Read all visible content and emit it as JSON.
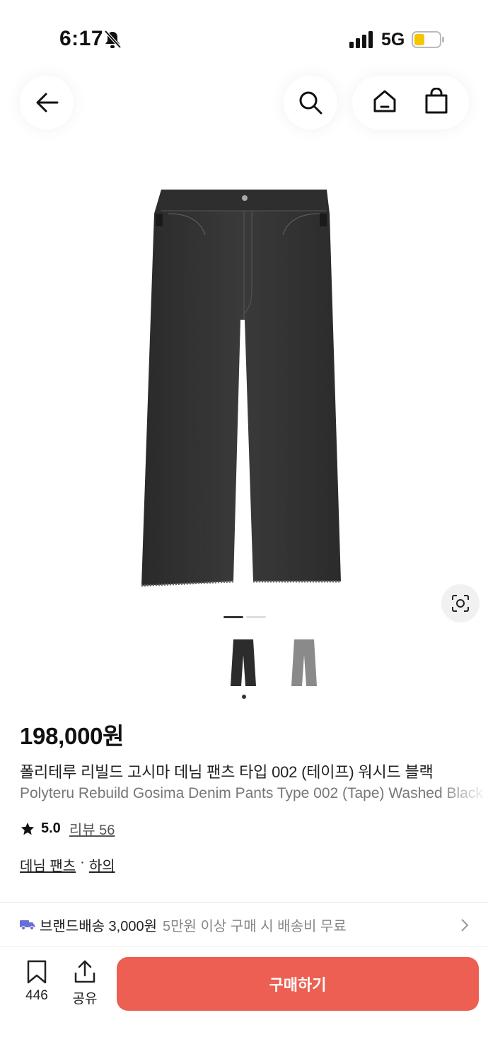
{
  "status_bar": {
    "time": "6:17",
    "network": "5G",
    "battery_color": "#f5c500"
  },
  "nav": {
    "back": "back-arrow-icon",
    "search": "search-icon",
    "home": "home-icon",
    "cart": "shopping-bag-icon"
  },
  "product": {
    "price": "198,000원",
    "name_ko": "폴리테루 리빌드 고시마 데님 팬츠 타입 002 (테이프) 워시드 블랙",
    "name_en": "Polyteru Rebuild Gosima Denim Pants Type 002 (Tape) Washed Black",
    "rating": "5.0",
    "review_label": "리뷰 56",
    "category": "데님 팬츠",
    "category_sep": "·",
    "subcategory": "하의",
    "image_count": 2,
    "current_image": 1
  },
  "shipping": {
    "label": "브랜드배송 3,000원",
    "note": "5만원 이상 구매 시 배송비 무료"
  },
  "bottom": {
    "bookmark_count": "446",
    "share_label": "공유",
    "buy_label": "구매하기",
    "buy_color": "#ec5f52"
  }
}
